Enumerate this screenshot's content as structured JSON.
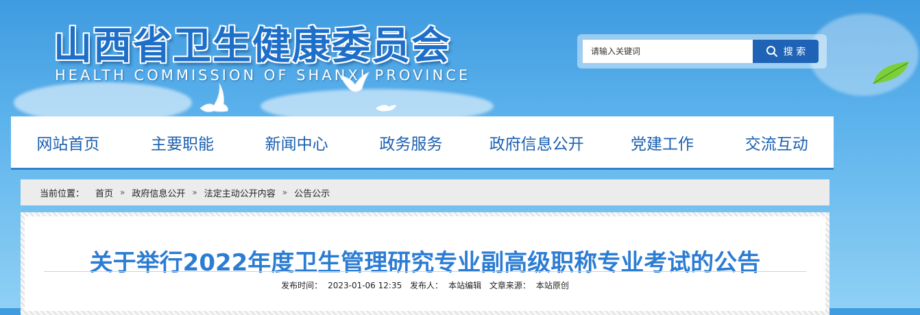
{
  "header": {
    "title_cn": "山西省卫生健康委员会",
    "title_en": "HEALTH COMMISSION OF SHANXI PROVINCE",
    "bird_icon": "dove-icon",
    "leaf_icon": "leaf-icon"
  },
  "search": {
    "placeholder": "请输入关键词",
    "button_label": "搜 索",
    "icon": "magnifier-icon"
  },
  "nav": {
    "items": [
      {
        "label": "网站首页"
      },
      {
        "label": "主要职能"
      },
      {
        "label": "新闻中心"
      },
      {
        "label": "政务服务"
      },
      {
        "label": "政府信息公开"
      },
      {
        "label": "党建工作"
      },
      {
        "label": "交流互动"
      }
    ]
  },
  "breadcrumb": {
    "label": "当前位置：",
    "separator": "»",
    "items": [
      "首页",
      "政府信息公开",
      "法定主动公开内容",
      "公告公示"
    ]
  },
  "article": {
    "title": "关于举行2022年度卫生管理研究专业副高级职称专业考试的公告",
    "meta": {
      "published_label": "发布时间：",
      "published": "2023-01-06 12:35",
      "publisher_label": "发布人：",
      "publisher": "本站编辑",
      "source_label": "文章来源：",
      "source": "本站原创"
    }
  },
  "colors": {
    "brand_blue": "#1d6fc9",
    "nav_text": "#1a5fb0",
    "nav_underline": "#2f80d0",
    "search_button": "#1f63b6",
    "article_title": "#2b7cd3"
  }
}
